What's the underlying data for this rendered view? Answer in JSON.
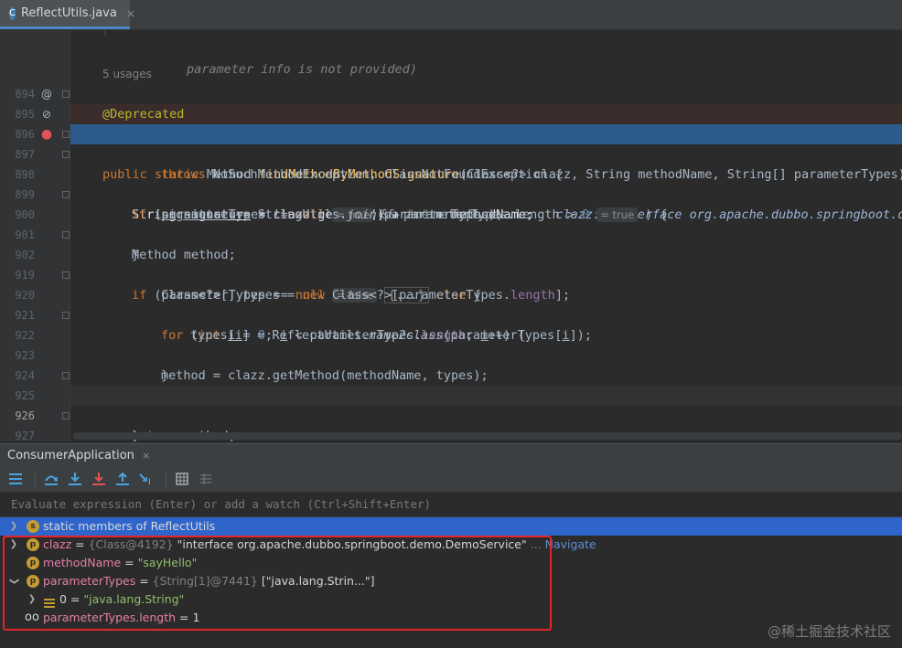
{
  "tab": {
    "title": "ReflectUtils.java",
    "close": "×",
    "icon_letter": "C"
  },
  "editor": {
    "comment_fragment": "parameter info is not provided)",
    "usages": "5 usages",
    "lines": [
      {
        "num": "894",
        "code_html": "annotation"
      },
      {
        "num": "895"
      },
      {
        "num": "896"
      },
      {
        "num": "897"
      },
      {
        "num": "898"
      },
      {
        "num": "899"
      },
      {
        "num": "900"
      },
      {
        "num": "901"
      },
      {
        "num": "902"
      },
      {
        "num": "919"
      },
      {
        "num": "920"
      },
      {
        "num": "921"
      },
      {
        "num": "922"
      },
      {
        "num": "923"
      },
      {
        "num": "924"
      },
      {
        "num": "925"
      },
      {
        "num": "926"
      },
      {
        "num": "927"
      },
      {
        "num": "928"
      }
    ],
    "code": {
      "l894": "@Deprecated",
      "l895_kw": "public static",
      "l895_type": "Method",
      "l895_fn": "findMethodByMethodSignature",
      "l895_rest": "(Class<?> clazz, String methodName, String[] parameterTypes)",
      "l896_kw": "throws",
      "l896_rest": "NoSuchMethodException, ClassNotFoundException {",
      "l897_a": "String",
      "l897_var": "signature",
      "l897_b": " = clazz.getName() + ",
      "l897_str": "\".\"",
      "l897_c": " + methodName;",
      "l897_hint": "clazz: \"interface org.apache.dubbo.springboot.dem",
      "l898_kw": "if",
      "l898_a": " (parameterTypes != ",
      "l898_null": "null",
      "l898_hint1": "= true",
      "l898_b": " && parameterTypes.length > ",
      "l898_num": "0",
      "l898_hint2": "= true",
      "l898_c": " ) {",
      "l899_var": "signature",
      "l899_a": " += StringUtils.",
      "l899_fn": "join",
      "l899_b": "(parameterTypes);",
      "l900": "}",
      "l901_a": "Method method;",
      "l902_kw": "if",
      "l902_a": " (parameterTypes == ",
      "l902_null": "null",
      "l902_hint": "= false",
      "l902_fold": "{...}",
      "l902_else": "else",
      "l902_b": " {",
      "l919_a": "Class<?>[] types = ",
      "l919_new": "new",
      "l919_b": " Class<?>[parameterTypes.",
      "l919_len": "length",
      "l919_c": "];",
      "l920_for": "for",
      "l920_a": " (",
      "l920_int": "int",
      "l920_i": "i",
      "l920_b": " = ",
      "l920_zero": "0",
      "l920_c": "; ",
      "l920_i2": "i",
      "l920_d": " < parameterTypes.",
      "l920_len": "length",
      "l920_e": "; ",
      "l920_i3": "i",
      "l920_f": "++) {",
      "l921_a": "types[",
      "l921_i": "i",
      "l921_b": "] = ReflectUtils.",
      "l921_fn": "name2class",
      "l921_c": "(parameterTypes[",
      "l921_i2": "i",
      "l921_d": "]);",
      "l922": "}",
      "l923": "method = clazz.getMethod(methodName, types);",
      "l925": "}",
      "l926_kw": "return",
      "l926_a": " method;",
      "l927": "}"
    }
  },
  "debug": {
    "title": "ConsumerApplication",
    "close": "×",
    "eval_placeholder": "Evaluate expression (Enter) or add a watch (Ctrl+Shift+Enter)",
    "variables": [
      {
        "name": "static members of ReflectUtils",
        "badge": "s"
      },
      {
        "name": "clazz",
        "badge": "p",
        "eq": " = ",
        "type": "{Class@4192}",
        "value": " \"interface org.apache.dubbo.springboot.demo.DemoService\"",
        "ellipsis": " ...",
        "link": " Navigate"
      },
      {
        "name": "methodName",
        "badge": "p",
        "eq": " = ",
        "value": "\"sayHello\""
      },
      {
        "name": "parameterTypes",
        "badge": "p",
        "eq": " = ",
        "type": "{String[1]@7441}",
        "value": " [\"java.lang.Strin...\"]"
      },
      {
        "name": "0",
        "eq": " = ",
        "value": "\"java.lang.String\""
      },
      {
        "name": "parameterTypes.length",
        "eq": " = ",
        "value": "1"
      }
    ]
  },
  "watermark": "@稀土掘金技术社区"
}
